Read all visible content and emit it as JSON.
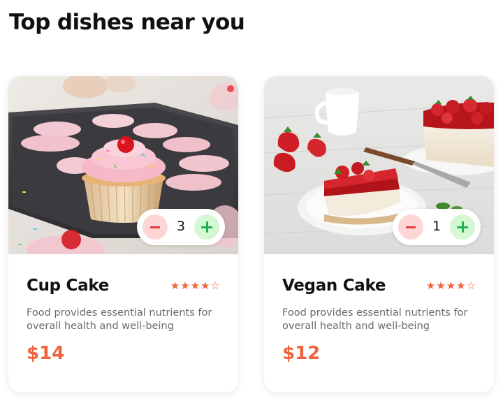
{
  "section": {
    "title": "Top dishes near you"
  },
  "colors": {
    "accent": "#f0643c",
    "minus": "#e83a3a",
    "plus": "#22b14c"
  },
  "dishes": [
    {
      "name": "Cup Cake",
      "rating": 4,
      "rating_max": 5,
      "description": "Food provides essential nutrients for overall health and well-being",
      "price": "$14",
      "quantity": "3",
      "image_icon": "cupcake-image"
    },
    {
      "name": "Vegan Cake",
      "rating": 4,
      "rating_max": 5,
      "description": "Food provides essential nutrients for overall health and well-being",
      "price": "$12",
      "quantity": "1",
      "image_icon": "strawberry-cheesecake-image"
    }
  ]
}
